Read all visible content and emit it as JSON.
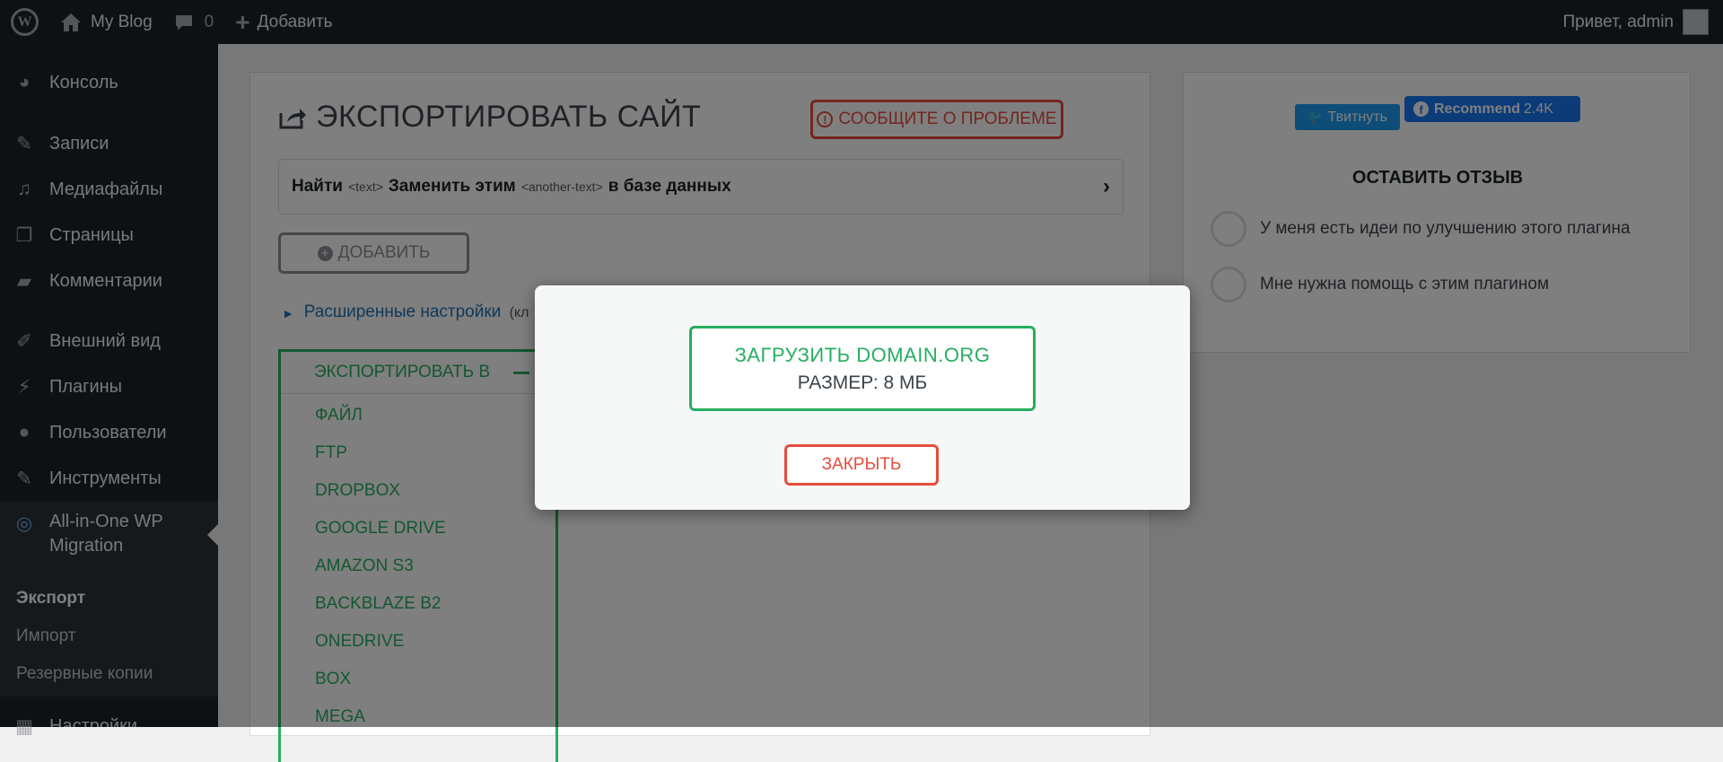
{
  "admin_bar": {
    "site_name": "My Blog",
    "comments_count": "0",
    "add_new": "Добавить",
    "greeting": "Привет, admin"
  },
  "sidebar": {
    "items": [
      {
        "label": "Консоль",
        "icon": "dashboard-icon"
      },
      {
        "label": "Записи",
        "icon": "pin-icon"
      },
      {
        "label": "Медиафайлы",
        "icon": "media-icon"
      },
      {
        "label": "Страницы",
        "icon": "pages-icon"
      },
      {
        "label": "Комментарии",
        "icon": "comment-icon"
      },
      {
        "label": "Внешний вид",
        "icon": "brush-icon"
      },
      {
        "label": "Плагины",
        "icon": "plugin-icon"
      },
      {
        "label": "Пользователи",
        "icon": "users-icon"
      },
      {
        "label": "Инструменты",
        "icon": "wrench-icon"
      },
      {
        "label": "All-in-One WP Migration",
        "icon": "migration-icon"
      },
      {
        "label": "Настройки",
        "icon": "settings-icon"
      }
    ],
    "submenu": [
      "Экспорт",
      "Импорт",
      "Резервные копии"
    ]
  },
  "export_page": {
    "title": "ЭКСПОРТИРОВАТЬ САЙТ",
    "report_problem": "СООБЩИТЕ О ПРОБЛЕМЕ",
    "find_label": "Найти",
    "find_placeholder": "<text>",
    "replace_label": "Заменить этим",
    "replace_placeholder": "<another-text>",
    "in_database": "в базе данных",
    "add_button": "ДОБАВИТЬ",
    "advanced": "Расширенные настройки",
    "advanced_suffix": "(кл",
    "export_to": "ЭКСПОРТИРОВАТЬ В",
    "export_options": [
      "ФАЙЛ",
      "FTP",
      "DROPBOX",
      "GOOGLE DRIVE",
      "AMAZON S3",
      "BACKBLAZE B2",
      "ONEDRIVE",
      "BOX",
      "MEGA"
    ]
  },
  "right_panel": {
    "tweet": "Твитнуть",
    "recommend": "Recommend",
    "recommend_count": "2.4K",
    "review_title": "ОСТАВИТЬ ОТЗЫВ",
    "options": [
      "У меня есть идеи по улучшению этого плагина",
      "Мне нужна помощь с этим плагином"
    ]
  },
  "modal": {
    "download_label": "ЗАГРУЗИТЬ DOMAIN.ORG",
    "size_label": "РАЗМЕР: 8 МБ",
    "close": "ЗАКРЫТЬ"
  },
  "colors": {
    "admin_dark": "#1d2327",
    "accent_green": "#27ae60",
    "accent_red": "#e74c3c",
    "link_blue": "#2271b1"
  }
}
